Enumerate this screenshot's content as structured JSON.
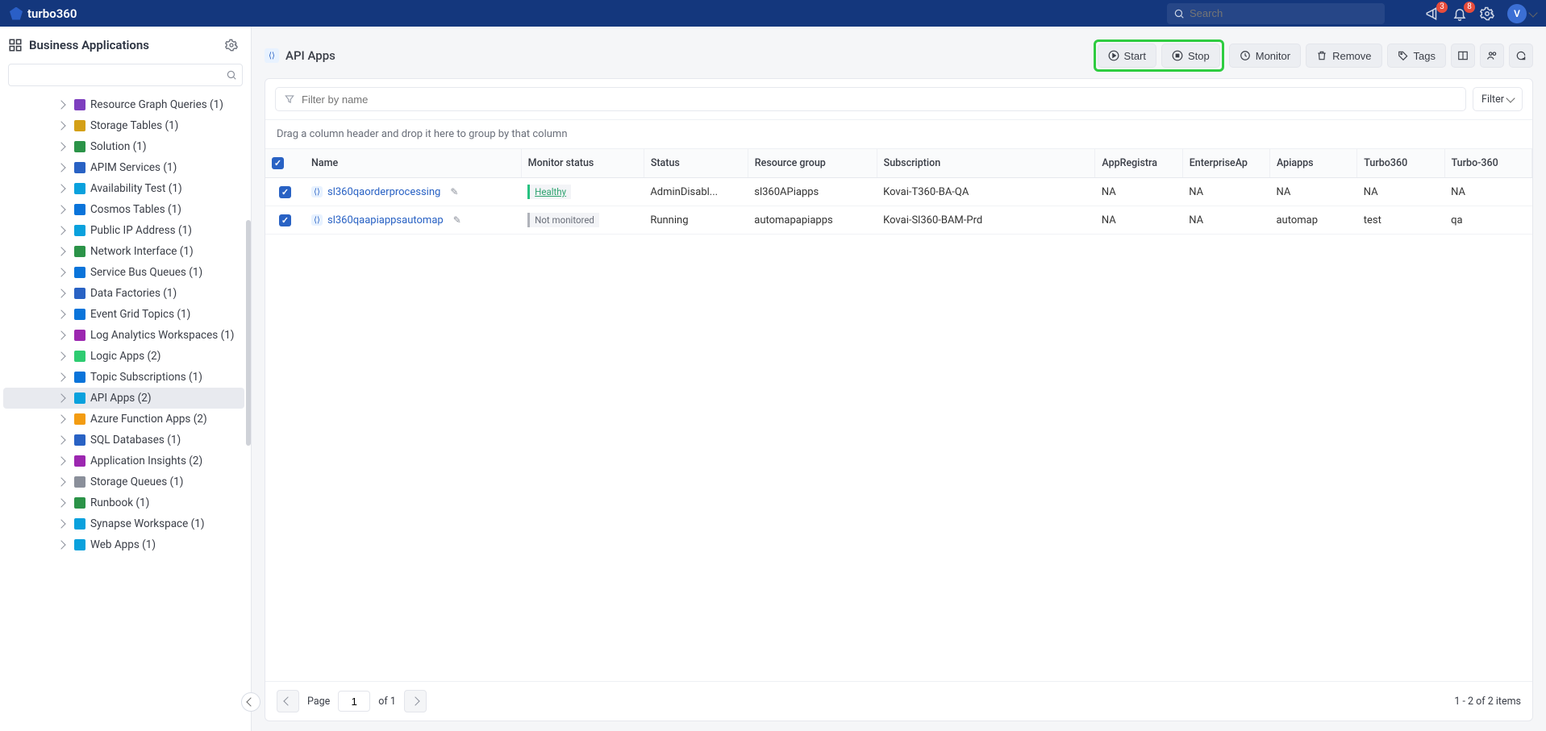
{
  "brand": "turbo360",
  "search": {
    "placeholder": "Search"
  },
  "notifications": {
    "announce_count": "3",
    "bell_count": "8"
  },
  "avatar": "V",
  "sidebar": {
    "title": "Business Applications",
    "items": [
      {
        "label": "Resource Graph Queries (1)",
        "color": "#7e3fbf"
      },
      {
        "label": "Storage Tables (1)",
        "color": "#d4a017"
      },
      {
        "label": "Solution (1)",
        "color": "#2b9348"
      },
      {
        "label": "APIM Services (1)",
        "color": "#2962c4"
      },
      {
        "label": "Availability Test (1)",
        "color": "#0aa1dd"
      },
      {
        "label": "Cosmos Tables (1)",
        "color": "#0a74da"
      },
      {
        "label": "Public IP Address (1)",
        "color": "#0aa1dd"
      },
      {
        "label": "Network Interface (1)",
        "color": "#2b9348"
      },
      {
        "label": "Service Bus Queues (1)",
        "color": "#0a74da"
      },
      {
        "label": "Data Factories (1)",
        "color": "#2962c4"
      },
      {
        "label": "Event Grid Topics (1)",
        "color": "#0a74da"
      },
      {
        "label": "Log Analytics Workspaces (1)",
        "color": "#9c27b0"
      },
      {
        "label": "Logic Apps (2)",
        "color": "#2ecc71"
      },
      {
        "label": "Topic Subscriptions (1)",
        "color": "#0a74da"
      },
      {
        "label": "API Apps (2)",
        "color": "#0aa1dd",
        "selected": true
      },
      {
        "label": "Azure Function Apps (2)",
        "color": "#f39c12"
      },
      {
        "label": "SQL Databases (1)",
        "color": "#2962c4"
      },
      {
        "label": "Application Insights (2)",
        "color": "#9c27b0"
      },
      {
        "label": "Storage Queues (1)",
        "color": "#8a8f9a"
      },
      {
        "label": "Runbook (1)",
        "color": "#2b9348"
      },
      {
        "label": "Synapse Workspace (1)",
        "color": "#0aa1dd"
      },
      {
        "label": "Web Apps (1)",
        "color": "#0aa1dd"
      }
    ]
  },
  "page": {
    "title": "API Apps"
  },
  "toolbar": {
    "start": "Start",
    "stop": "Stop",
    "monitor": "Monitor",
    "remove": "Remove",
    "tags": "Tags"
  },
  "filter": {
    "placeholder": "Filter by name",
    "filter_label": "Filter"
  },
  "group_hint": "Drag a column header and drop it here to group by that column",
  "columns": [
    "Name",
    "Monitor status",
    "Status",
    "Resource group",
    "Subscription",
    "AppRegistra",
    "EnterpriseAp",
    "Apiapps",
    "Turbo360",
    "Turbo-360"
  ],
  "rows": [
    {
      "name": "sl360qaorderprocessing",
      "monitor": {
        "text": "Healthy",
        "cls": "healthy"
      },
      "status": "AdminDisabl...",
      "rg": "sl360APiapps",
      "sub": "Kovai-T360-BA-QA",
      "appreg": "NA",
      "ent": "NA",
      "api": "NA",
      "t360": "NA",
      "t360b": "NA"
    },
    {
      "name": "sl360qaapiappsautomap",
      "monitor": {
        "text": "Not monitored",
        "cls": "notmon"
      },
      "status": "Running",
      "rg": "automapapiapps",
      "sub": "Kovai-Sl360-BAM-Prd",
      "appreg": "NA",
      "ent": "NA",
      "api": "automap",
      "t360": "test",
      "t360b": "qa"
    }
  ],
  "paging": {
    "page_label": "Page",
    "page": "1",
    "of": "of 1",
    "summary": "1 - 2 of 2 items"
  }
}
